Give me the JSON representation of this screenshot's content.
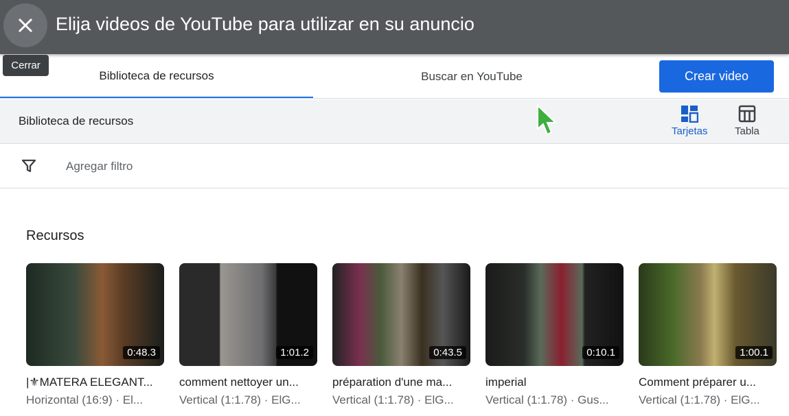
{
  "dialog": {
    "title": "Elija videos de YouTube para utilizar en su anuncio",
    "close_tooltip": "Cerrar"
  },
  "tabs": [
    {
      "label": "Biblioteca de recursos",
      "active": true
    },
    {
      "label": "Buscar en YouTube",
      "active": false
    }
  ],
  "create_button": "Crear video",
  "library_bar": {
    "title": "Biblioteca de recursos",
    "views": [
      {
        "label": "Tarjetas",
        "selected": true,
        "icon": "cards-icon"
      },
      {
        "label": "Tabla",
        "selected": false,
        "icon": "table-icon"
      }
    ]
  },
  "filter": {
    "placeholder": "Agregar filtro"
  },
  "section_title": "Recursos",
  "colors": {
    "accent": "#1a73e8",
    "header": "#55585b"
  },
  "cards": [
    {
      "title": "|⚜MATERA ELEGANT...",
      "subtitle": "Horizontal (16:9) · El...",
      "duration": "0:48.3"
    },
    {
      "title": "comment nettoyer un...",
      "subtitle": "Vertical (1:1.78) · ElG...",
      "duration": "1:01.2"
    },
    {
      "title": "préparation d'une ma...",
      "subtitle": "Vertical (1:1.78) · ElG...",
      "duration": "0:43.5"
    },
    {
      "title": "imperial",
      "subtitle": "Vertical (1:1.78) · Gus...",
      "duration": "0:10.1"
    },
    {
      "title": "Comment préparer u...",
      "subtitle": "Vertical (1:1.78) · ElG...",
      "duration": "1:00.1"
    }
  ]
}
